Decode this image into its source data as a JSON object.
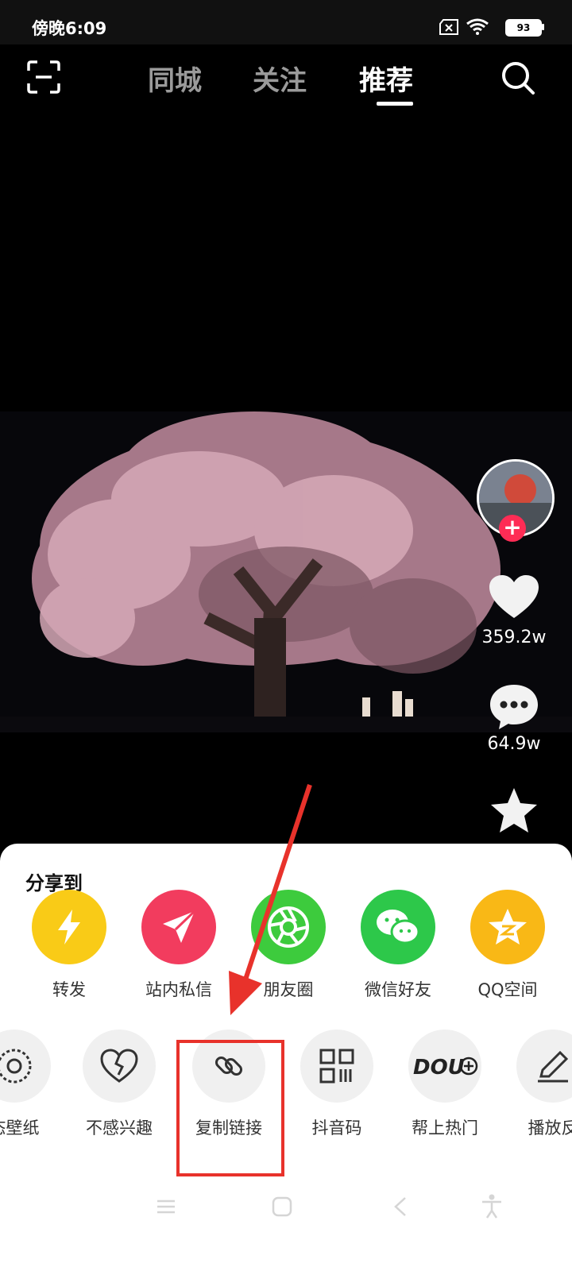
{
  "status": {
    "time": "傍晚6:09",
    "battery": "93"
  },
  "tabs": [
    {
      "label": "同城"
    },
    {
      "label": "关注"
    },
    {
      "label": "推荐",
      "active": true
    }
  ],
  "rail": {
    "likes": "359.2w",
    "comments": "64.9w"
  },
  "share_sheet": {
    "title": "分享到",
    "targets": [
      {
        "label": "转发",
        "color": "#F9CB17",
        "icon": "lightning-icon"
      },
      {
        "label": "站内私信",
        "color": "#F23C5E",
        "icon": "paper-plane-icon"
      },
      {
        "label": "朋友圈",
        "color": "#3DCB3D",
        "icon": "aperture-icon"
      },
      {
        "label": "微信好友",
        "color": "#2DC84A",
        "icon": "wechat-icon"
      },
      {
        "label": "QQ空间",
        "color": "#F9B816",
        "icon": "qzone-star-icon"
      }
    ],
    "actions": [
      {
        "label": "态壁纸",
        "icon": "live-wallpaper-icon"
      },
      {
        "label": "不感兴趣",
        "icon": "broken-heart-icon"
      },
      {
        "label": "复制链接",
        "icon": "link-icon"
      },
      {
        "label": "抖音码",
        "icon": "qr-code-icon"
      },
      {
        "label": "帮上热门",
        "icon": "dou-plus-icon"
      },
      {
        "label": "播放反",
        "icon": "pencil-icon"
      }
    ]
  }
}
